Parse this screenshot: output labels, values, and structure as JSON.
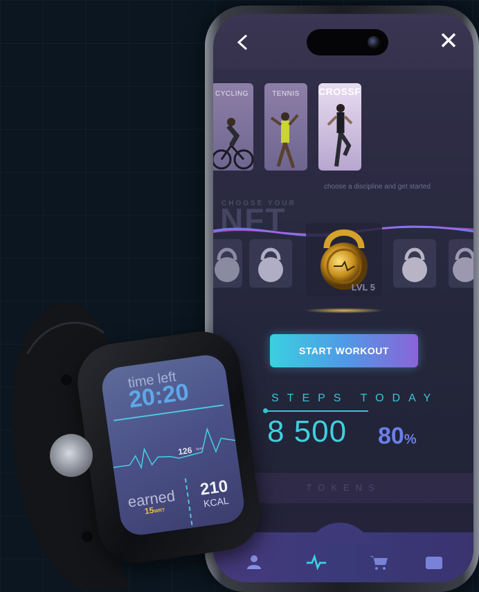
{
  "phone": {
    "disciplines": [
      {
        "label": "CYCLING",
        "selected": false
      },
      {
        "label": "TENNIS",
        "selected": false
      },
      {
        "label": "CROSSFIT",
        "selected": true
      }
    ],
    "hint": "choose a discipline and get started",
    "choose_label": "CHOOSE YOUR",
    "nft_label": "NFT",
    "selected_level": "LVL 5",
    "start_button": "START WORKOUT",
    "steps": {
      "title": "STEPS TODAY",
      "value": "8 500",
      "percent": "80",
      "percent_sign": "%"
    },
    "tokens_label": "TOKENS",
    "tabs": [
      "profile-icon",
      "pulse-icon",
      "cart-icon",
      "wallet-icon"
    ],
    "active_tab": "pulse-icon",
    "accent": "#3fd0e0"
  },
  "watch": {
    "title": "time left",
    "time": "20:20",
    "bpm": "126",
    "bpm_unit": "bpm",
    "earned_label": "earned",
    "earned_value": "15",
    "earned_unit": "WRT",
    "kcal_value": "210",
    "kcal_label": "KCAL"
  }
}
